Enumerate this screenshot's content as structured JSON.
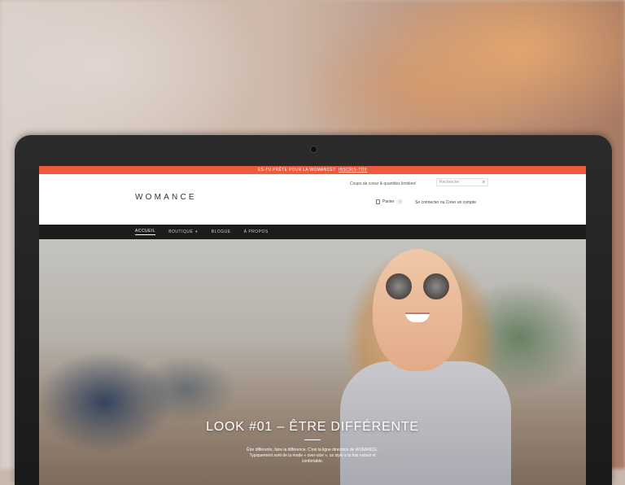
{
  "promo": {
    "text": "ES-TU PRÊTE POUR LA WOMANCE?",
    "link": "INSCRIS-TOI!"
  },
  "header": {
    "logo": "WOMANCE",
    "tagline": "Coups de coeur & quantités limitées!",
    "search_placeholder": "Recherche",
    "cart_label": "Panier",
    "cart_count": "0",
    "account_link": "Se connecter ou Créer un compte"
  },
  "nav": {
    "items": [
      {
        "label": "ACCUEIL"
      },
      {
        "label": "BOUTIQUE"
      },
      {
        "label": "BLOGUE"
      },
      {
        "label": "À PROPOS"
      }
    ]
  },
  "hero": {
    "title": "LOOK #01 – ÊTRE DIFFÉRENTE",
    "description": "Être différente, faire la différence. C'est la ligne directrice de WOMANCE. Typiquement sorti de la mode « over-size », ce style a la fois estival et confortable."
  },
  "colors": {
    "accent": "#f05a3c",
    "nav_bg": "#1c1c1c"
  }
}
